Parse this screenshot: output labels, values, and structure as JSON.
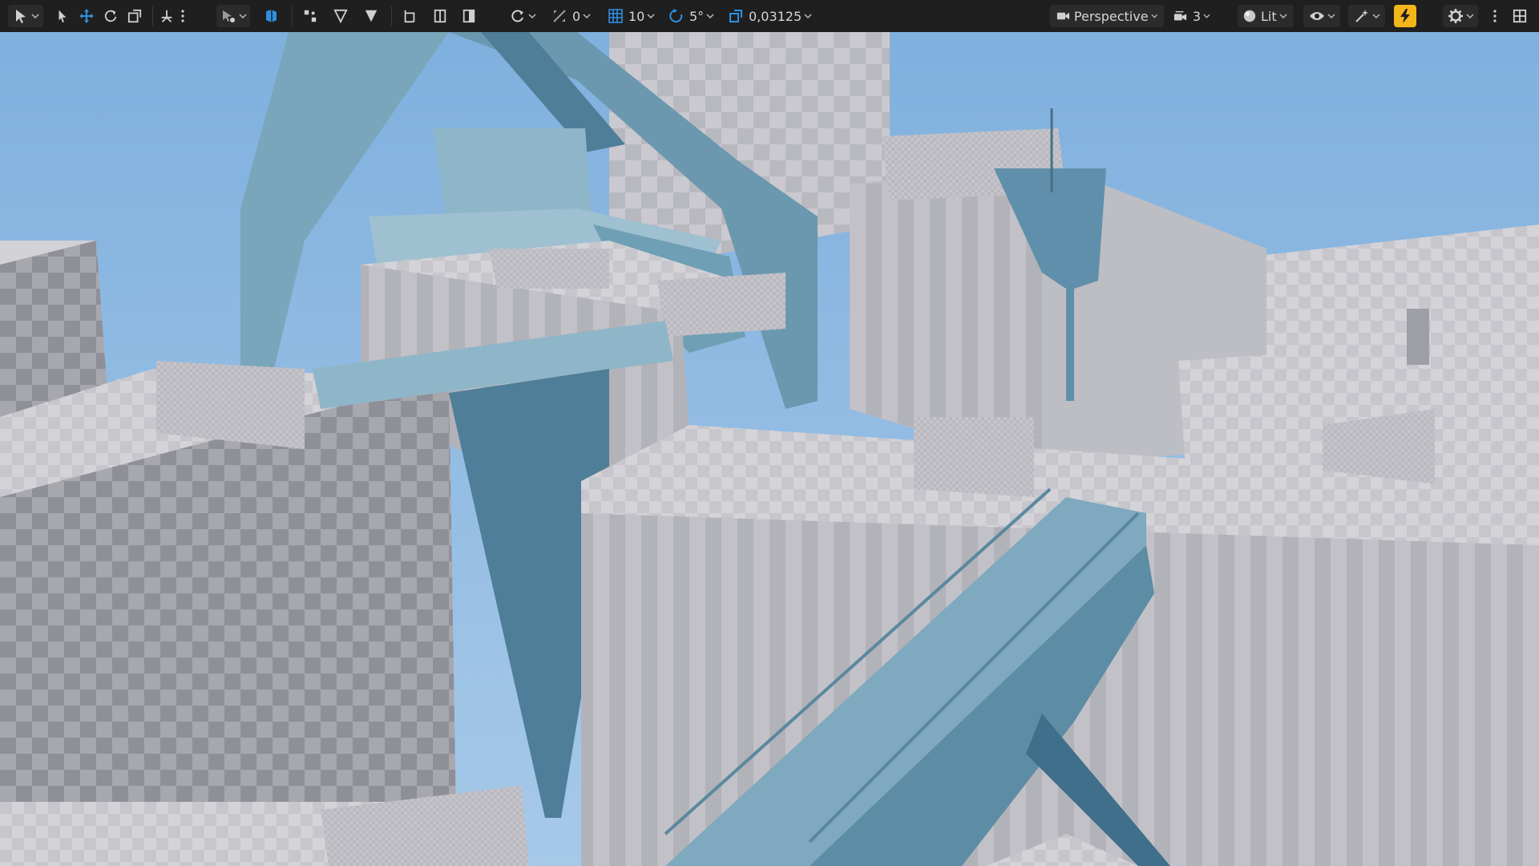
{
  "toolbar": {
    "snap_translate_value": "0",
    "grid_value": "10",
    "rotation_value": "5°",
    "scale_value": "0,03125",
    "view_mode_label": "Perspective",
    "camera_speed_value": "3",
    "lighting_mode_label": "Lit"
  },
  "icons": {
    "select_mode": "select-mode-icon",
    "select": "arrow-pointer-icon",
    "translate": "move-arrows-icon",
    "rotate": "rotate-icon",
    "scale": "scale-icon",
    "pivot": "pivot-icon",
    "more": "kebab-icon",
    "transform_settings": "transform-settings-icon",
    "world_local": "world-local-icon",
    "snap_surface": "snap-surface-icon",
    "play_mode": "play-triangle-icon",
    "play_filled": "play-filled-icon",
    "bookmark": "bookmark-icon",
    "split_view": "split-view-icon",
    "half_box": "half-box-icon",
    "camera": "camera-icon",
    "speed": "camera-speed-icon",
    "lit": "lit-sphere-icon",
    "show": "eye-icon",
    "effects": "sparkle-icon",
    "realtime": "realtime-lightning-icon",
    "settings": "gear-icon",
    "layout": "grid-layout-icon"
  },
  "colors": {
    "toolbar_bg": "#1f1f1f",
    "accent_blue": "#2f8fe0",
    "realtime_yellow": "#f2b619",
    "sky": "#8cb7df",
    "building_grey": "#b5b5ba",
    "blue_structure": "#6f9fb5"
  }
}
